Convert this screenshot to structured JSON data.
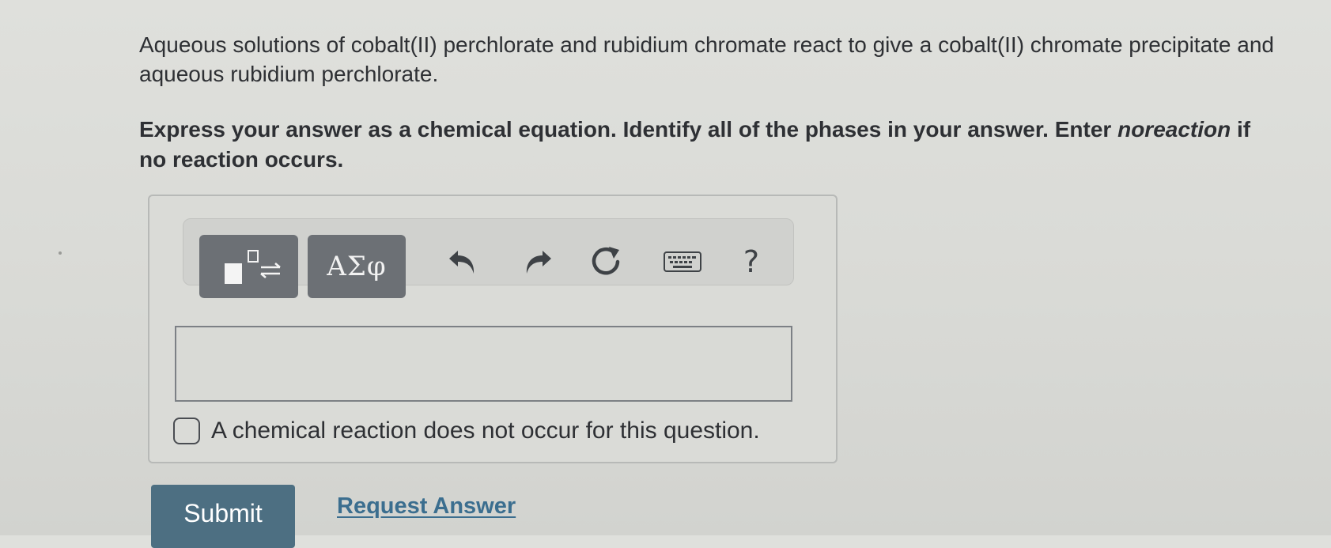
{
  "question": {
    "text": "Aqueous solutions of cobalt(II) perchlorate and rubidium chromate react to give a cobalt(II) chromate precipitate and aqueous rubidium perchlorate."
  },
  "instruction": {
    "lead": "Express your answer as a chemical equation. Identify all of the phases in your answer. Enter ",
    "keyword": "noreaction",
    "tail": " if no reaction occurs."
  },
  "toolbar": {
    "greek_label": "ΑΣφ",
    "help_label": "?",
    "icons": [
      "templates-icon",
      "undo-icon",
      "redo-icon",
      "reset-icon",
      "keyboard-icon",
      "help-icon"
    ]
  },
  "answer": {
    "value": "",
    "no_reaction_label": "A chemical reaction does not occur for this question.",
    "no_reaction_checked": false
  },
  "actions": {
    "submit_label": "Submit",
    "request_label": "Request Answer"
  },
  "colors": {
    "submit_bg": "#4d6f82",
    "link": "#3b6e8f",
    "toolbar_button": "#6c7075"
  }
}
